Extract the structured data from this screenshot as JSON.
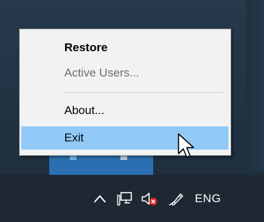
{
  "context_menu": {
    "items": [
      {
        "label": "Restore",
        "state": "default-bold"
      },
      {
        "label": "Active Users...",
        "state": "disabled"
      },
      {
        "label": "About...",
        "state": "normal"
      },
      {
        "label": "Exit",
        "state": "highlighted"
      }
    ],
    "highlight_color": "#91c9f7",
    "background_color": "#f2f2f2"
  },
  "taskbar": {
    "background_color": "#1d2833",
    "tray": {
      "icons": [
        "chevron-up-icon",
        "network-icon",
        "volume-muted-icon",
        "pen-ink-icon"
      ],
      "language": "ENG"
    }
  }
}
